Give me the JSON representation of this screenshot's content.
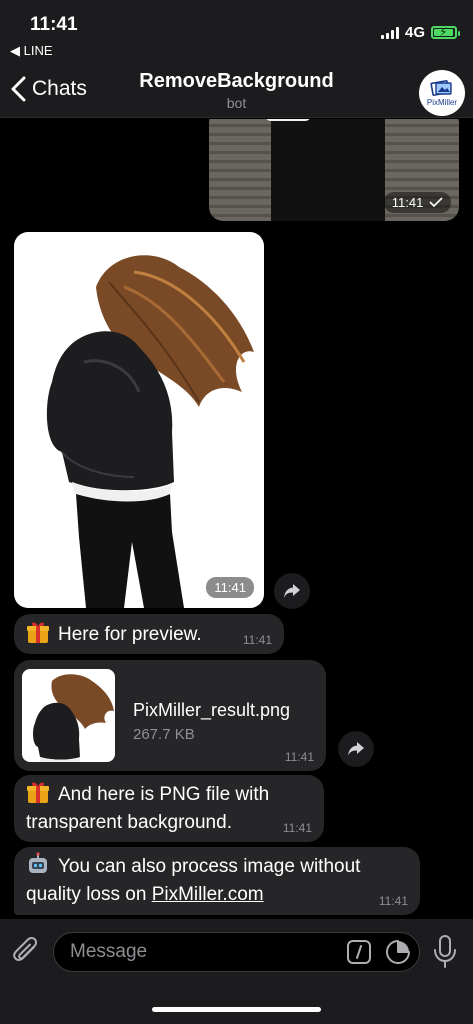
{
  "status_bar": {
    "time": "11:41",
    "back_app": "◀ LINE",
    "network": "4G"
  },
  "nav": {
    "back_label": "Chats",
    "title": "RemoveBackground",
    "subtitle": "bot",
    "avatar_text": "PixMiller"
  },
  "messages": {
    "sent_photo_time": "11:41",
    "received_photo_time": "11:41",
    "preview_text": "Here for preview.",
    "preview_time": "11:41",
    "file_name": "PixMiller_result.png",
    "file_size": "267.7 KB",
    "file_time": "11:41",
    "png_text_line1": "And here is PNG file with",
    "png_text_line2": "transparent background.",
    "png_time": "11:41",
    "process_text_line1": "You can also process image without",
    "process_text_line2": "quality loss on ",
    "process_link": "PixMiller.com",
    "process_time": "11:41"
  },
  "composer": {
    "placeholder": "Message"
  },
  "colors": {
    "bubble": "#262628",
    "bar": "#1c1c1e",
    "battery": "#4cd964"
  },
  "icons": [
    "back-chevron-icon",
    "gift-icon",
    "robot-icon",
    "share-icon",
    "attach-icon",
    "command-icon",
    "sticker-icon",
    "mic-icon",
    "checkmark-icon"
  ]
}
